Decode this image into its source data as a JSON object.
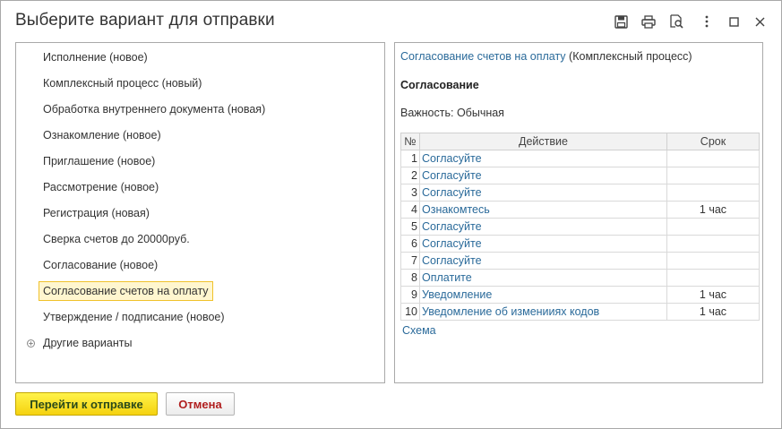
{
  "window": {
    "title": "Выберите вариант для отправки",
    "icons": [
      "save-icon",
      "print-icon",
      "preview-icon",
      "more-icon",
      "maximize-icon",
      "close-icon"
    ]
  },
  "variants": {
    "items": [
      "Исполнение (новое)",
      "Комплексный процесс (новый)",
      "Обработка внутреннего документа (новая)",
      "Ознакомление (новое)",
      "Приглашение (новое)",
      "Рассмотрение (новое)",
      "Регистрация (новая)",
      "Сверка счетов до 20000руб.",
      "Согласование (новое)",
      "Согласование счетов на оплату",
      "Утверждение / подписание (новое)"
    ],
    "selected_index": 9,
    "other_variants": "Другие варианты"
  },
  "details": {
    "process_link": "Согласование счетов на оплату",
    "process_type": "(Комплексный процесс)",
    "stage_title": "Согласование",
    "importance_label": "Важность:",
    "importance_value": "Обычная",
    "table": {
      "headers": [
        "№",
        "Действие",
        "Срок"
      ],
      "rows": [
        {
          "num": "1",
          "action": "Согласуйте",
          "duration": ""
        },
        {
          "num": "2",
          "action": "Согласуйте",
          "duration": ""
        },
        {
          "num": "3",
          "action": "Согласуйте",
          "duration": ""
        },
        {
          "num": "4",
          "action": "Ознакомтесь",
          "duration": "1 час"
        },
        {
          "num": "5",
          "action": "Согласуйте",
          "duration": ""
        },
        {
          "num": "6",
          "action": "Согласуйте",
          "duration": ""
        },
        {
          "num": "7",
          "action": "Согласуйте",
          "duration": ""
        },
        {
          "num": "8",
          "action": "Оплатите",
          "duration": ""
        },
        {
          "num": "9",
          "action": "Уведомление",
          "duration": "1 час"
        },
        {
          "num": "10",
          "action": "Уведомление об изменииях кодов",
          "duration": "1 час"
        }
      ]
    },
    "scheme_link": "Схема"
  },
  "buttons": {
    "submit": "Перейти к отправке",
    "cancel": "Отмена"
  },
  "colors": {
    "link": "#2a6a9a",
    "selection_bg": "#fff6cf",
    "selection_border": "#f0c22c",
    "primary_button": "#f5d20f",
    "cancel_text": "#b01e1e"
  }
}
